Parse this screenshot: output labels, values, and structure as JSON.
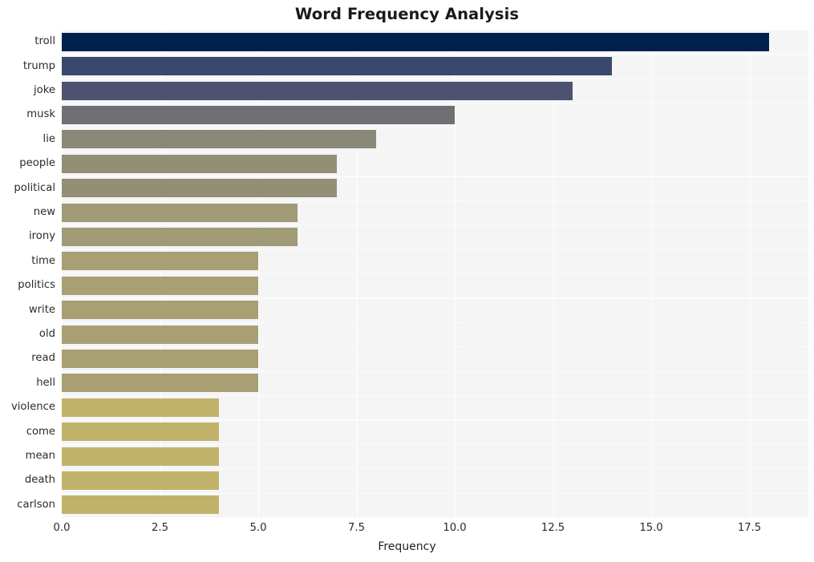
{
  "chart_data": {
    "type": "bar",
    "orientation": "horizontal",
    "title": "Word Frequency Analysis",
    "xlabel": "Frequency",
    "ylabel": "",
    "categories": [
      "troll",
      "trump",
      "joke",
      "musk",
      "lie",
      "people",
      "political",
      "new",
      "irony",
      "time",
      "politics",
      "write",
      "old",
      "read",
      "hell",
      "violence",
      "come",
      "mean",
      "death",
      "carlson"
    ],
    "values": [
      18,
      14,
      13,
      10,
      8,
      7,
      7,
      6,
      6,
      5,
      5,
      5,
      5,
      5,
      5,
      4,
      4,
      4,
      4,
      4
    ],
    "bar_colors": [
      "#01214c",
      "#3a486c",
      "#4c5270",
      "#6e7074",
      "#8a8878",
      "#938f77",
      "#938f77",
      "#a09a76",
      "#a09a76",
      "#a89f73",
      "#a89f73",
      "#a89f73",
      "#a89f73",
      "#a89f73",
      "#a89f73",
      "#c0b369",
      "#c0b369",
      "#c0b369",
      "#c0b369",
      "#c0b369"
    ],
    "xticks": [
      "0.0",
      "2.5",
      "5.0",
      "7.5",
      "10.0",
      "12.5",
      "15.0",
      "17.5"
    ],
    "xtick_values": [
      0,
      2.5,
      5,
      7.5,
      10,
      12.5,
      15,
      17.5
    ],
    "xlim": [
      0,
      19
    ],
    "grid": true,
    "legend": "none",
    "plot_background": "#f5f5f6",
    "gridline_color": "#ffffff",
    "figure_background": "#ffffff"
  }
}
